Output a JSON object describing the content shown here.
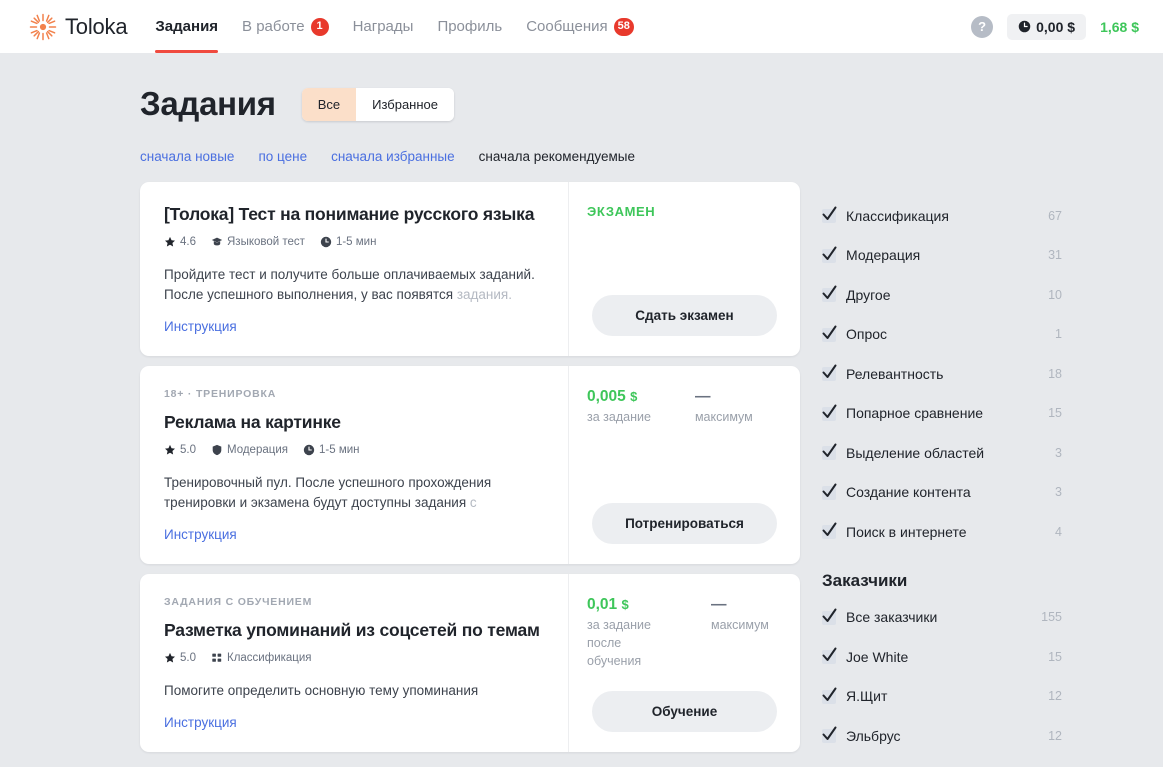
{
  "header": {
    "logo_text": "Toloka",
    "logo_icon": "toloka-sunburst-icon",
    "nav": [
      {
        "label": "Задания",
        "active": true,
        "badge": ""
      },
      {
        "label": "В работе",
        "active": false,
        "badge": "1"
      },
      {
        "label": "Награды",
        "active": false,
        "badge": ""
      },
      {
        "label": "Профиль",
        "active": false,
        "badge": ""
      },
      {
        "label": "Сообщения",
        "active": false,
        "badge": "58"
      }
    ],
    "help_icon": "question-mark-icon",
    "help_label": "?",
    "pending_balance": "0,00 $",
    "pending_icon": "clock-icon",
    "available_balance": "1,68 $",
    "available_color": "#3ec65a"
  },
  "main": {
    "title": "Задания",
    "segmented": [
      {
        "label": "Все",
        "active": true
      },
      {
        "label": "Избранное",
        "active": false
      }
    ],
    "sort_links": [
      {
        "label": "сначала новые",
        "current": false
      },
      {
        "label": "по цене",
        "current": false
      },
      {
        "label": "сначала избранные",
        "current": false
      },
      {
        "label": "сначала рекомендуемые",
        "current": true
      }
    ],
    "cards": [
      {
        "kicker": "",
        "title": "[Толока] Тест на понимание русского языка",
        "rating": "4.6",
        "category": "Языковой тест",
        "category_icon": "graduation-cap-icon",
        "duration": "1-5 мин",
        "duration_icon": "clock-icon",
        "desc": "Пройдите тест и получите больше оплачиваемых заданий. После успешного выполнения, у вас появятся ",
        "desc_faded": "задания.",
        "instruction": "Инструкция",
        "exam_label": "ЭКЗАМЕН",
        "price": "",
        "price_sub": "",
        "max_value": "",
        "max_label": "",
        "button": "Сдать экзамен"
      },
      {
        "kicker": "18+ · ТРЕНИРОВКА",
        "title": "Реклама на картинке",
        "rating": "5.0",
        "category": "Модерация",
        "category_icon": "shield-icon",
        "duration": "1-5 мин",
        "duration_icon": "clock-icon",
        "desc": "Тренировочный пул. После успешного прохождения тренировки и экзамена будут доступны задания ",
        "desc_faded": "с",
        "instruction": "Инструкция",
        "exam_label": "",
        "price": "0,005",
        "currency": "$",
        "price_sub": "за задание",
        "max_value": "—",
        "max_label": "максимум",
        "button": "Потренироваться"
      },
      {
        "kicker": "ЗАДАНИЯ С ОБУЧЕНИЕМ",
        "title": "Разметка упоминаний из соцсетей по темам",
        "rating": "5.0",
        "category": "Классификация",
        "category_icon": "classification-grid-icon",
        "duration": "",
        "duration_icon": "",
        "desc": "Помогите определить основную тему упоминания",
        "desc_faded": "",
        "instruction": "Инструкция",
        "exam_label": "",
        "price": "0,01",
        "currency": "$",
        "price_sub": "за задание после обучения",
        "max_value": "—",
        "max_label": "максимум",
        "button": "Обучение"
      }
    ]
  },
  "sidebar": {
    "filters": [
      {
        "label": "Классификация",
        "count": "67",
        "checked": true
      },
      {
        "label": "Модерация",
        "count": "31",
        "checked": true
      },
      {
        "label": "Другое",
        "count": "10",
        "checked": true
      },
      {
        "label": "Опрос",
        "count": "1",
        "checked": true
      },
      {
        "label": "Релевантность",
        "count": "18",
        "checked": true
      },
      {
        "label": "Попарное сравнение",
        "count": "15",
        "checked": true
      },
      {
        "label": "Выделение областей",
        "count": "3",
        "checked": true
      },
      {
        "label": "Создание контента",
        "count": "3",
        "checked": true
      },
      {
        "label": "Поиск в интернете",
        "count": "4",
        "checked": true
      }
    ],
    "requesters_heading": "Заказчики",
    "requesters": [
      {
        "label": "Все заказчики",
        "count": "155",
        "checked": true
      },
      {
        "label": "Joe White",
        "count": "15",
        "checked": true
      },
      {
        "label": "Я.Щит",
        "count": "12",
        "checked": true
      },
      {
        "label": "Эльбрус",
        "count": "12",
        "checked": true
      }
    ]
  }
}
